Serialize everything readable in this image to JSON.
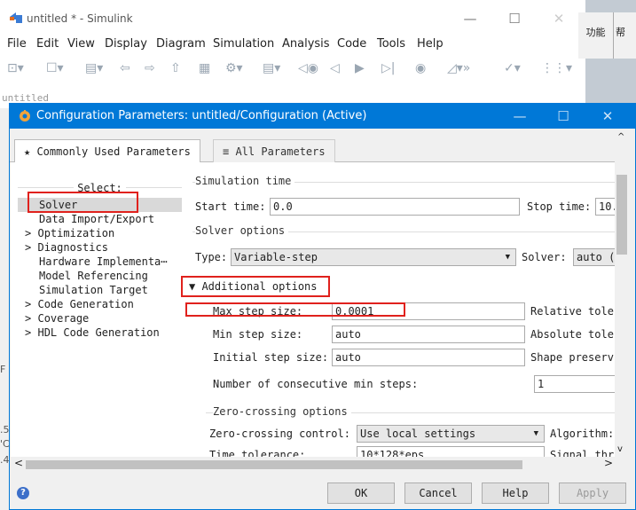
{
  "bg_window": {
    "title": "untitled * - Simulink",
    "menu": [
      "File",
      "Edit",
      "View",
      "Display",
      "Diagram",
      "Simulation",
      "Analysis",
      "Code",
      "Tools",
      "Help"
    ],
    "tab_label": "untitled",
    "right_btn1": "功能",
    "right_btn2": "帮",
    "left_marks": [
      "F",
      ".5",
      "'C",
      ".4"
    ]
  },
  "dialog": {
    "title": "Configuration Parameters: untitled/Configuration (Active)",
    "tabs": [
      {
        "label": "★ Commonly Used Parameters"
      },
      {
        "label": "≡ All Parameters"
      }
    ],
    "tree": {
      "header": "Select:",
      "items": [
        {
          "label": "Solver",
          "expander": "",
          "selected": true
        },
        {
          "label": "Data Import/Export",
          "expander": ""
        },
        {
          "label": "Optimization",
          "expander": ">"
        },
        {
          "label": "Diagnostics",
          "expander": ">"
        },
        {
          "label": "Hardware Implementa⋯",
          "expander": ""
        },
        {
          "label": "Model Referencing",
          "expander": ""
        },
        {
          "label": "Simulation Target",
          "expander": ""
        },
        {
          "label": "Code Generation",
          "expander": ">"
        },
        {
          "label": "Coverage",
          "expander": ">"
        },
        {
          "label": "HDL Code Generation",
          "expander": ">"
        }
      ]
    },
    "simulation_time": {
      "group": "Simulation time",
      "start_label": "Start time:",
      "start_value": "0.0",
      "stop_label": "Stop time:",
      "stop_value": "10."
    },
    "solver_options": {
      "group": "Solver options",
      "type_label": "Type:",
      "type_value": "Variable-step",
      "solver_label": "Solver:",
      "solver_value": "auto (A"
    },
    "additional": {
      "label": "▼ Additional options",
      "max_step_label": "Max step size:",
      "max_step_value": "0.0001",
      "relative_label": "Relative tole",
      "min_step_label": "Min step size:",
      "min_step_value": "auto",
      "absolute_label": "Absolute tole",
      "initial_step_label": "Initial step size:",
      "initial_step_value": "auto",
      "shape_label": "Shape preserv",
      "consecutive_label": "Number of consecutive min steps:",
      "consecutive_value": "1"
    },
    "zero_crossing": {
      "group": "Zero-crossing options",
      "control_label": "Zero-crossing control:",
      "control_value": "Use local settings",
      "algorithm_label": "Algorithm:",
      "time_tol_label": "Time tolerance:",
      "time_tol_value": "10*128*eps",
      "signal_label": "Signal thr"
    },
    "buttons": {
      "ok": "OK",
      "cancel": "Cancel",
      "help": "Help",
      "apply": "Apply"
    }
  },
  "colors": {
    "accent": "#0078d7",
    "highlight_box": "#e0211d"
  }
}
